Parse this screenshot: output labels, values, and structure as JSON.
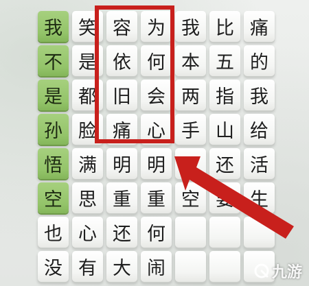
{
  "board": {
    "rows": [
      [
        "我",
        "笑",
        "容",
        "为",
        "我",
        "比",
        "痛"
      ],
      [
        "不",
        "是",
        "依",
        "何",
        "本",
        "五",
        "的"
      ],
      [
        "是",
        "都",
        "旧",
        "会",
        "两",
        "指",
        "我"
      ],
      [
        "孙",
        "脸",
        "痛",
        "心",
        "手",
        "山",
        "给"
      ],
      [
        "悟",
        "满",
        "明",
        "明",
        "",
        "还",
        "活"
      ],
      [
        "空",
        "思",
        "重",
        "重",
        "空",
        "要",
        "生"
      ],
      [
        "也",
        "心",
        "还",
        "何",
        "",
        "",
        ""
      ],
      [
        "没",
        "有",
        "大",
        "闹",
        "",
        "",
        ""
      ]
    ],
    "solved_column": 0,
    "solved_rows": [
      0,
      1,
      2,
      3,
      4,
      5
    ],
    "highlighted_columns": [
      2,
      3
    ],
    "highlighted_rows": [
      0,
      1,
      2,
      3
    ]
  },
  "colors": {
    "solved_tile": "#9ccb74",
    "highlight": "#c8201c",
    "arrow": "#c8201c"
  },
  "watermark": {
    "text": "九游",
    "icon": "jiuyou-logo-icon"
  }
}
